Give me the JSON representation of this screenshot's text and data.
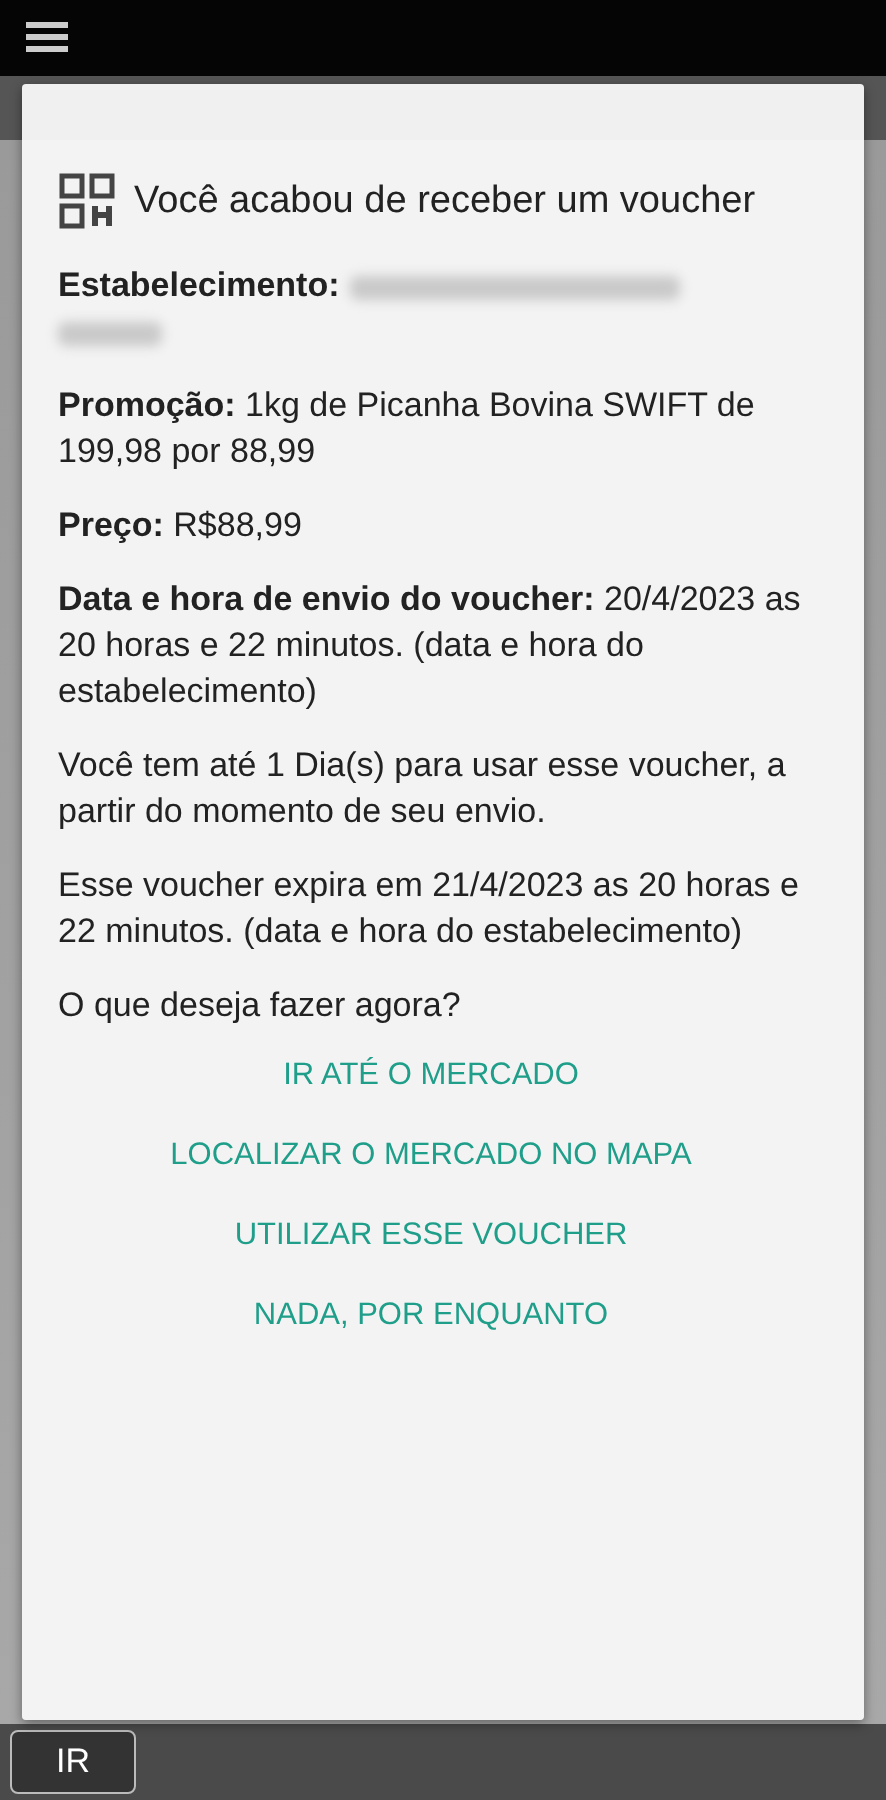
{
  "dialog": {
    "title": "Você acabou de receber um voucher",
    "fields": [
      {
        "kind": "redacted",
        "label": "Estabelecimento:"
      },
      {
        "kind": "text",
        "label": "Promoção:",
        "value": "1kg de Picanha Bovina SWIFT de 199,98 por 88,99"
      },
      {
        "kind": "text",
        "label": "Preço:",
        "value": "R$88,99"
      },
      {
        "kind": "text",
        "label": "Data e hora de envio do voucher:",
        "value": "20/4/2023 as 20 horas e 22 minutos. (data e hora do estabelecimento)"
      }
    ],
    "paragraphs": [
      "Você tem até 1 Dia(s) para usar esse voucher, a partir do momento de seu envio.",
      "Esse voucher expira em 21/4/2023 as 20 horas e 22 minutos. (data e hora do estabelecimento)"
    ],
    "question": "O que deseja fazer agora?",
    "actions": [
      "IR ATÉ O MERCADO",
      "LOCALIZAR O MERCADO NO MAPA",
      "UTILIZAR ESSE VOUCHER",
      "NADA, POR ENQUANTO"
    ]
  },
  "bottom_bar": {
    "go_button": "IR"
  }
}
